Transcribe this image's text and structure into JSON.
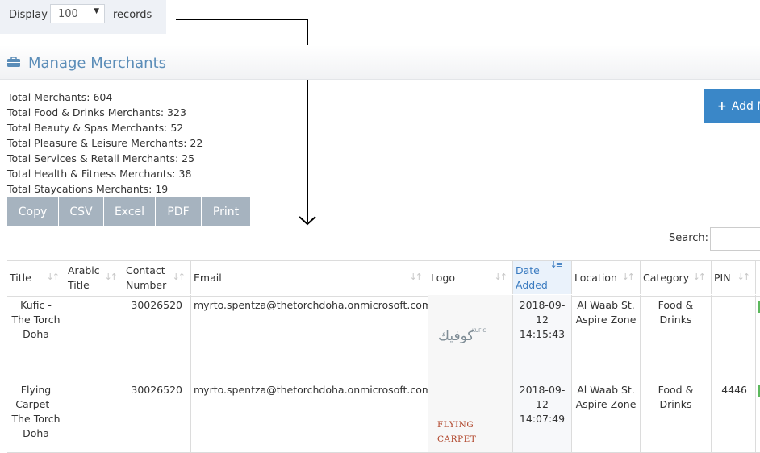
{
  "length_menu": {
    "prefix": "Display",
    "selected": "100",
    "suffix": "records"
  },
  "page": {
    "title": "Manage Merchants"
  },
  "stats": [
    "Total Merchants: 604",
    "Total Food & Drinks Merchants: 323",
    "Total Beauty & Spas Merchants: 52",
    "Total Pleasure & Leisure Merchants: 22",
    "Total Services & Retail Merchants: 25",
    "Total Health & Fitness Merchants: 38",
    "Total Staycations Merchants: 19"
  ],
  "add_button": {
    "label": "Add M"
  },
  "export_buttons": [
    "Copy",
    "CSV",
    "Excel",
    "PDF",
    "Print"
  ],
  "search": {
    "label": "Search:",
    "value": ""
  },
  "table": {
    "columns": [
      "Title",
      "Arabic Title",
      "Contact Number",
      "Email",
      "Logo",
      "Date Added",
      "Location",
      "Category",
      "PIN"
    ],
    "sorted_column": "Date Added",
    "rows": [
      {
        "title": "Kufic - The Torch Doha",
        "arabic_title": "",
        "contact": "30026520",
        "email": "myrto.spentza@thetorchdoha.onmicrosoft.com",
        "logo": "كوفيك KUFIC",
        "date": "2018-09-12",
        "time": "14:15:43",
        "location_line1": "Al Waab St.",
        "location_line2": "Aspire Zone",
        "category_line1": "Food &",
        "category_line2": "Drinks",
        "pin": ""
      },
      {
        "title": "Flying Carpet - The Torch Doha",
        "arabic_title": "",
        "contact": "30026520",
        "email": "myrto.spentza@thetorchdoha.onmicrosoft.com",
        "logo": "FLYING CARPET",
        "date": "2018-09-12",
        "time": "14:07:49",
        "location_line1": "Al Waab St.",
        "location_line2": "Aspire Zone",
        "category_line1": "Food &",
        "category_line2": "Drinks",
        "pin": "4446"
      }
    ]
  },
  "colors": {
    "accent": "#3a87c8",
    "title": "#5b8db8",
    "export": "#a6b3bf",
    "active_status": "#5cb85c"
  }
}
